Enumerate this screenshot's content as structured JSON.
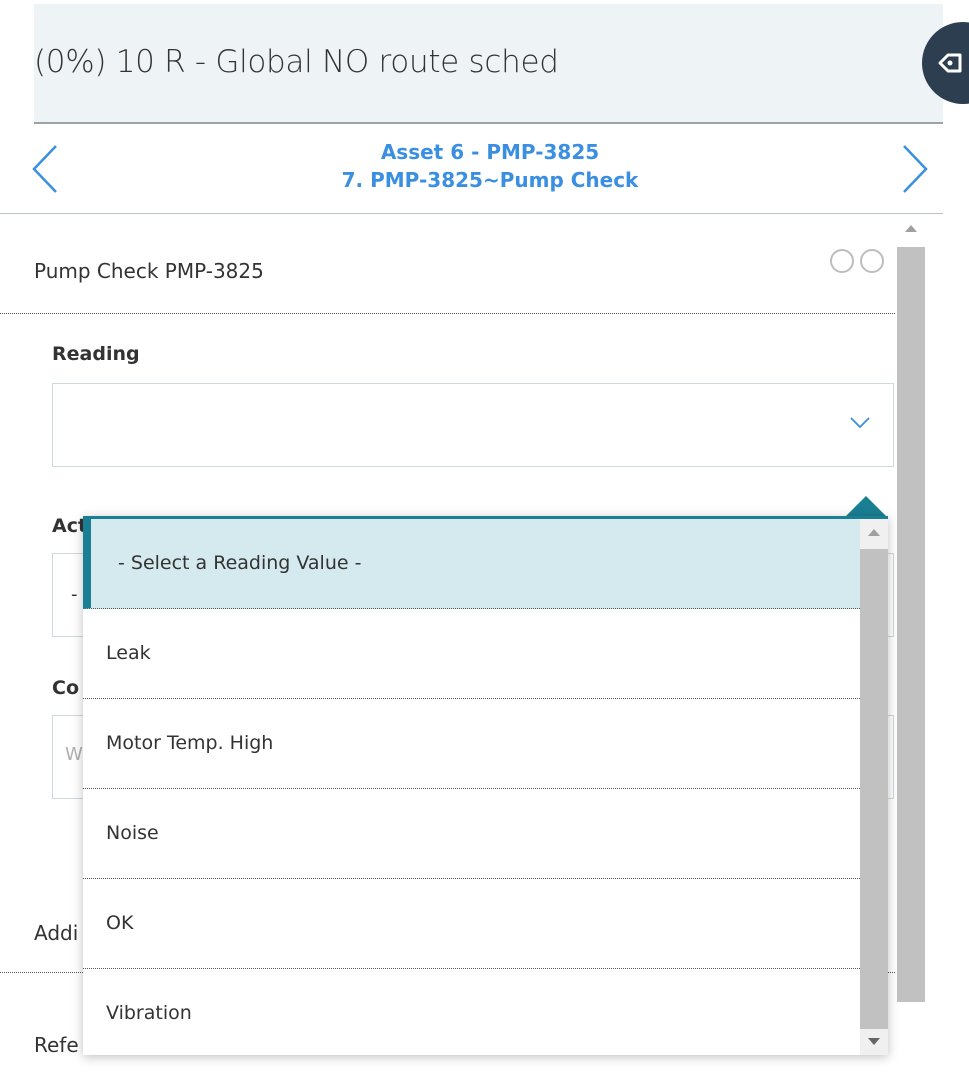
{
  "header": {
    "title": "(0%) 10 R - Global NO route sched"
  },
  "nav": {
    "asset_line": "Asset 6 - PMP-3825",
    "step_line": "7. PMP-3825~Pump Check"
  },
  "section": {
    "title": "Pump Check PMP-3825"
  },
  "reading": {
    "label": "Reading",
    "value": ""
  },
  "action": {
    "label_partial": "Act",
    "value_partial": "-"
  },
  "comment": {
    "label_partial": "Co",
    "placeholder_partial": "W"
  },
  "additional": {
    "label_partial": "Addi"
  },
  "reference": {
    "label_partial": "Refe"
  },
  "dropdown": {
    "options": [
      "- Select a Reading Value -",
      "Leak",
      "Motor Temp. High",
      "Noise",
      "OK",
      "Vibration"
    ],
    "selected_index": 0
  },
  "colors": {
    "accent": "#1a7f93",
    "link": "#3b8fe0",
    "header_bg": "#eef3f6",
    "selected_bg": "#d5eaee"
  },
  "icons": [
    "chevron-left-icon",
    "chevron-right-icon",
    "chevron-down-icon",
    "sidebar-toggle-icon",
    "device-status-icon",
    "cloud-status-icon"
  ]
}
